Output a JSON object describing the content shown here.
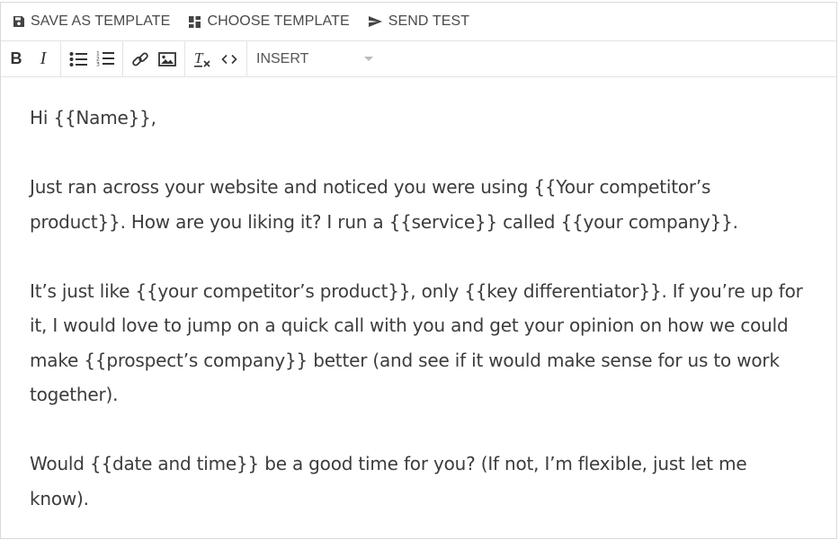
{
  "top_toolbar": {
    "save_template": "SAVE AS TEMPLATE",
    "choose_template": "CHOOSE TEMPLATE",
    "send_test": "SEND TEST"
  },
  "format_bar": {
    "bold": "B",
    "italic": "I",
    "insert_label": "INSERT"
  },
  "editor": {
    "paragraphs": [
      "Hi {{Name}},",
      "Just ran across your website and noticed you were using {{Your competitor’s product}}. How are you liking it? I run a {{service}} called {{your company}}.",
      "It’s just like {{your competitor’s product}}, only {{key differentiator}}. If you’re up for it, I would love to jump on a quick call with you and get your opinion on how we could make {{prospect’s company}} better (and see if it would make sense for us to work together).",
      "Would {{date and time}} be a good time for you? (If not, I’m flexible, just let me know)."
    ]
  }
}
